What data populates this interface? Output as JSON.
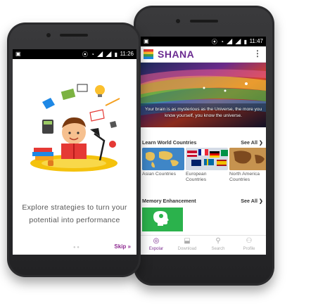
{
  "phone1": {
    "status_time": "11:26",
    "tagline_line1": "Explore strategies to turn your",
    "tagline_line2": "potential into performance",
    "skip_label": "Skip »"
  },
  "phone2": {
    "status_time": "11:47",
    "app_name": "SHANA",
    "hero_text_line1": "Your brain is as mysterious as the Universe, the more you",
    "hero_text_line2": "know yourself, you know the universe.",
    "section1_title": "Learn World Countries",
    "section1_see_all": "See All ❯",
    "cards": [
      {
        "label": "Asian Countries"
      },
      {
        "label": "European Countries"
      },
      {
        "label": "North America Countries"
      }
    ],
    "section2_title": "Memory Enhancement",
    "section2_see_all": "See All ❯",
    "bottom_nav": [
      "Expolar",
      "Download",
      "Search",
      "Profile"
    ]
  },
  "colors": {
    "brand_purple": "#6b2c91",
    "memory_green": "#2bb24c",
    "phone_body": "#2b2b2d"
  }
}
